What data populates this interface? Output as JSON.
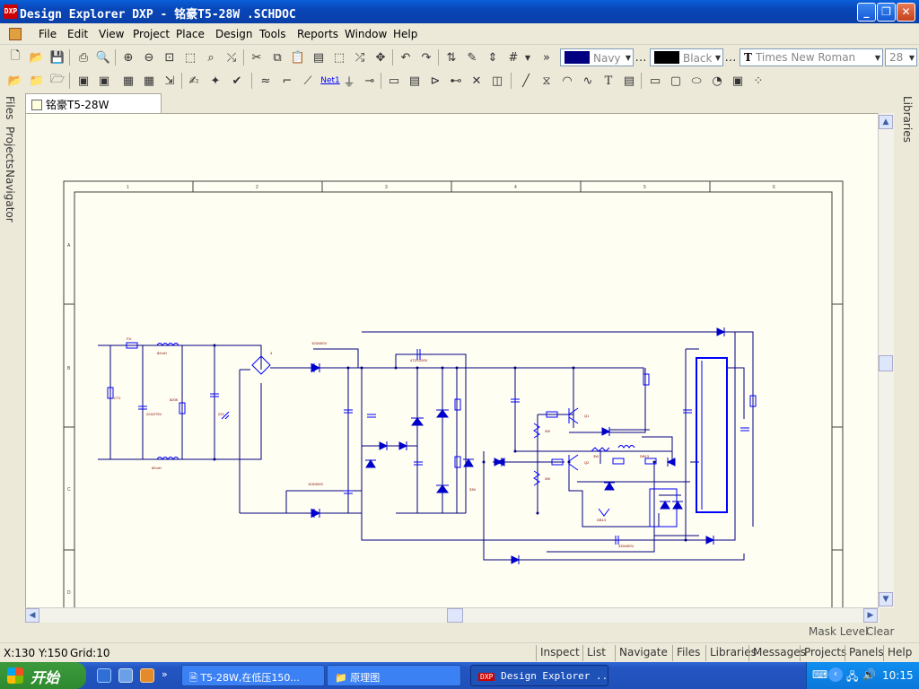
{
  "window": {
    "title": "Design Explorer DXP - 铭豪T5-28W .SCHDOC",
    "app_icon_text": "DXP",
    "minimize": "_",
    "maximize": "❐",
    "close": "✕"
  },
  "menu": [
    "File",
    "Edit",
    "View",
    "Project",
    "Place",
    "Design",
    "Tools",
    "Reports",
    "Window",
    "Help"
  ],
  "toolbar": {
    "color_fill": {
      "label": "Navy",
      "color": "#000080"
    },
    "color_border": {
      "label": "Black",
      "color": "#000000"
    },
    "font": "Times New Roman",
    "font_icon": "T",
    "font_size": "28",
    "net_label_text": "Net1",
    "more_glyph": "»"
  },
  "left_panels": [
    "Files",
    "Projects",
    "Navigator"
  ],
  "right_panels": [
    "Libraries"
  ],
  "document_tab": "铭豪T5-28W .SCHDOC",
  "mask_bar": {
    "mask_level": "Mask Level",
    "clear": "Clear"
  },
  "status": {
    "coords": "X:130 Y:150",
    "grid": "Grid:10"
  },
  "panel_buttons": [
    "Inspect",
    "List",
    "Navigate",
    "Files",
    "Libraries",
    "Messages",
    "Projects",
    "Panels",
    "Help"
  ],
  "taskbar": {
    "start": "开始",
    "tasks": [
      {
        "label": "T5-28W,在低压150...",
        "icon": "word-doc-icon",
        "active": false
      },
      {
        "label": "原理图",
        "icon": "folder-icon",
        "active": false
      },
      {
        "label": "Design Explorer ...",
        "icon": "dxp-app-icon",
        "active": true
      }
    ],
    "clock": "10:15"
  },
  "schematic": {
    "labels": {
      "r_top": "FU",
      "l1": "82mH",
      "l2": "82mH",
      "cx": "224/275V",
      "rx": "820K",
      "ct": "CT1",
      "sw": "222",
      "bridge": "4",
      "c_top": "103/400V",
      "c_bot": "103/400V",
      "c_mid": "472/1200V",
      "t1": "Q1",
      "t2": "Q2",
      "cap_r": "222/1kv",
      "lamp_cap": "333/400V",
      "d_label": "DB13",
      "r1": "3W",
      "r2": "3W",
      "r3": "3W",
      "r4": "33K"
    },
    "border_cols": [
      "1",
      "2",
      "3",
      "4",
      "5",
      "6"
    ],
    "border_rows": [
      "A",
      "B",
      "C",
      "D"
    ]
  },
  "colors": {
    "wire": "#000080",
    "component": "#0000ff",
    "diode": "#0000cc",
    "label": "#800000",
    "sheet_border": "#404040"
  }
}
